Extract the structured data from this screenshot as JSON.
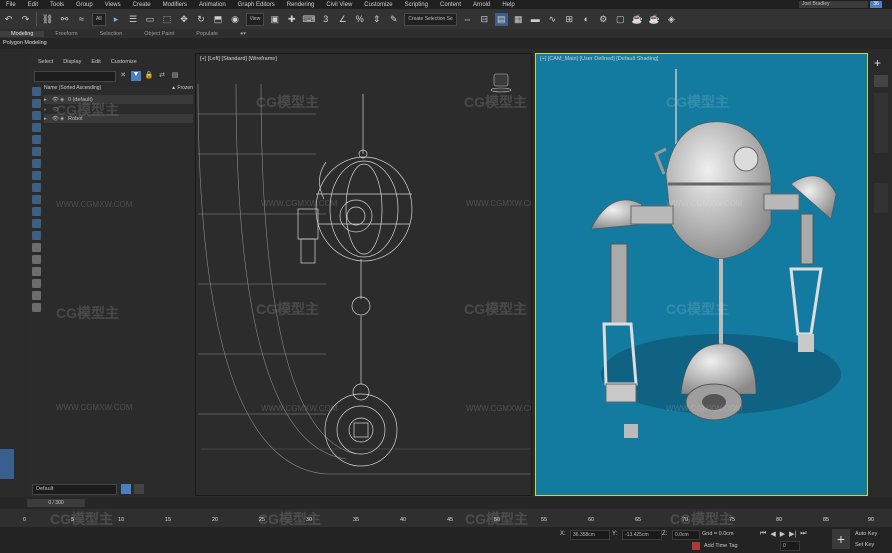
{
  "menu": [
    "File",
    "Edit",
    "Tools",
    "Group",
    "Views",
    "Create",
    "Modifiers",
    "Animation",
    "Graph Editors",
    "Rendering",
    "Civil View",
    "Customize",
    "Scripting",
    "Content",
    "Arnold",
    "Help"
  ],
  "user": {
    "name": "Joel Bradley",
    "badge": "36"
  },
  "toolbar": {
    "filter_all": "All",
    "view_select": "View",
    "selection_set": "Create Selection Se"
  },
  "ribbon": {
    "tabs": [
      "Modeling",
      "Freeform",
      "Selection",
      "Object Paint",
      "Populate"
    ],
    "active_tab": "Modeling",
    "sub_label": "Polygon Modeling"
  },
  "explorer": {
    "menu": [
      "Select",
      "Display",
      "Edit",
      "Customize"
    ],
    "header_name": "Name (Sorted Ascending)",
    "header_frozen": "▲ Frozen",
    "rows": [
      "0 (default)",
      "Robot"
    ]
  },
  "layer": {
    "current": "Default"
  },
  "viewports": {
    "left_label": "[+] [Left] [Standard] [Wireframe]",
    "right_label": "[+] [CAM_Main] [User Defined] [Default Shading]"
  },
  "watermark": {
    "brand": "CG模型主",
    "url": "WWW.CGMXW.COM"
  },
  "timeline": {
    "slider": "0 / 300",
    "ticks": [
      "0",
      "5",
      "10",
      "15",
      "20",
      "25",
      "30",
      "35",
      "40",
      "45",
      "50",
      "55",
      "60",
      "65",
      "70",
      "75",
      "80",
      "85",
      "90"
    ]
  },
  "status": {
    "x_label": "X:",
    "x_value": "36.358cm",
    "y_label": "Y:",
    "y_value": "-13.425cm",
    "z_label": "Z:",
    "z_value": "0.0cm",
    "grid": "Grid = 0.0cm",
    "add_time_tag": "Add Time Tag",
    "frame": "0",
    "auto_key": "Auto Key",
    "set_key": "Set Key"
  },
  "colors": {
    "accent": "#4a7fc1",
    "viewport_bg": "#137aa0",
    "active_border": "#c5d84c"
  }
}
